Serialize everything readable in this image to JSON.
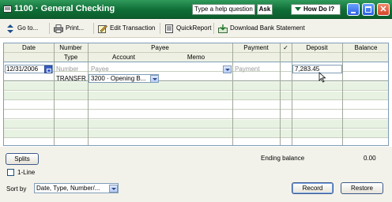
{
  "window": {
    "title": "1100 · General Checking",
    "help_placeholder": "Type a help question",
    "ask_label": "Ask",
    "howdoi_label": "How Do I?"
  },
  "toolbar": {
    "goto": "Go to...",
    "print": "Print...",
    "edit_transaction": "Edit Transaction",
    "quickreport": "QuickReport",
    "download": "Download Bank Statement"
  },
  "register": {
    "header1": [
      "Date",
      "Number",
      "Payee",
      "Payment",
      "✓",
      "Deposit",
      "Balance"
    ],
    "header2": [
      "Type",
      "Account",
      "Memo"
    ],
    "entry": {
      "date": "12/31/2006",
      "number_placeholder": "Number",
      "payee_placeholder": "Payee",
      "payment_placeholder": "Payment",
      "deposit": "7,283.45",
      "type": "TRANSFR",
      "account": "3200 · Opening B..."
    }
  },
  "bottom": {
    "splits_label": "Splits",
    "oneline_label": "1-Line",
    "sortby_label": "Sort by",
    "sortby_value": "Date, Type, Number/...",
    "ending_balance_label": "Ending balance",
    "ending_balance_value": "0.00",
    "record_label": "Record",
    "restore_label": "Restore"
  },
  "colors": {
    "title_green": "#0f6d36",
    "row_green": "#e8f2e2",
    "header_bg": "#eef0e3"
  }
}
